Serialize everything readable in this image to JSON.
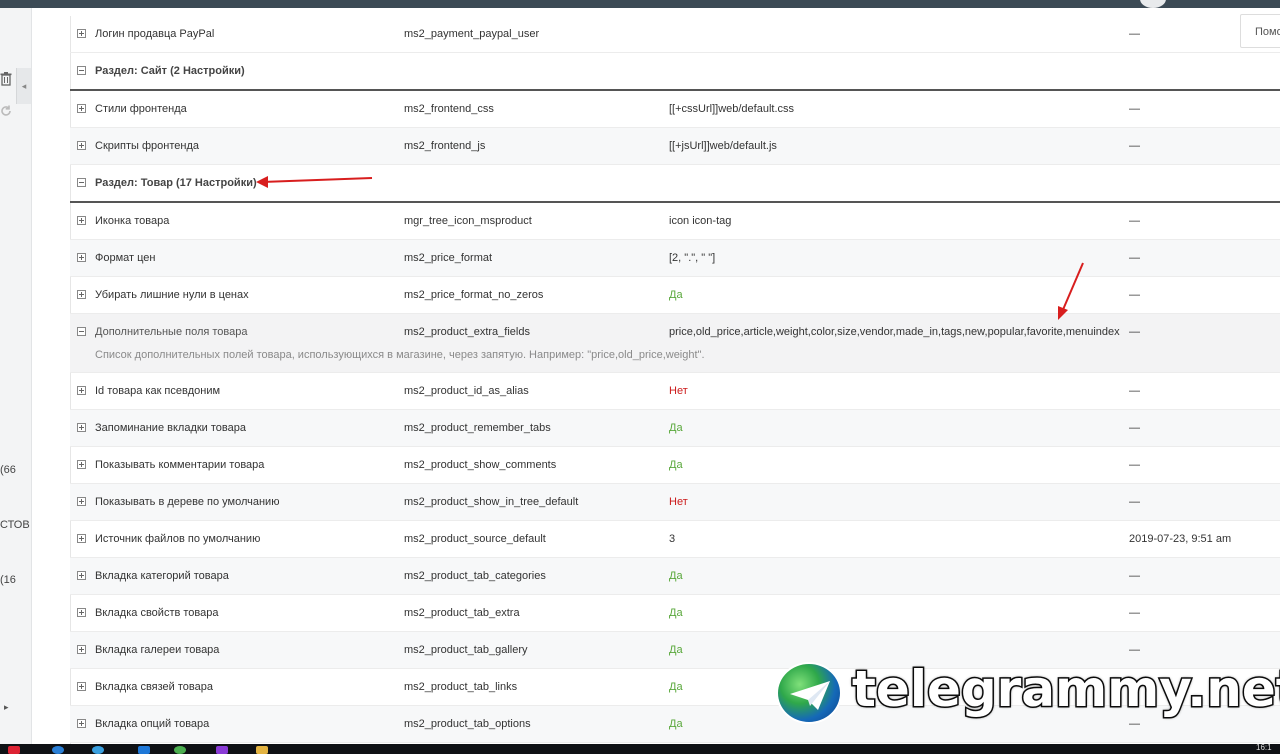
{
  "help_button": {
    "label": "Помо"
  },
  "sidebar": {
    "texts": [
      "(66",
      "СТОВ",
      "(16"
    ]
  },
  "rows": [
    {
      "type": "setting",
      "expanded": false,
      "name": "Логин продавца PayPal",
      "key": "ms2_payment_paypal_user",
      "value": "",
      "value_kind": "text",
      "date": "—"
    },
    {
      "type": "group",
      "label": "Раздел: Сайт (2 Настройки)"
    },
    {
      "type": "setting",
      "expanded": false,
      "name": "Стили фронтенда",
      "key": "ms2_frontend_css",
      "value": "[[+cssUrl]]web/default.css",
      "value_kind": "text",
      "date": "—"
    },
    {
      "type": "setting",
      "expanded": false,
      "name": "Скрипты фронтенда",
      "key": "ms2_frontend_js",
      "value": "[[+jsUrl]]web/default.js",
      "value_kind": "text",
      "date": "—"
    },
    {
      "type": "group",
      "label": "Раздел: Товар (17 Настройки)"
    },
    {
      "type": "setting",
      "expanded": false,
      "name": "Иконка товара",
      "key": "mgr_tree_icon_msproduct",
      "value": "icon icon-tag",
      "value_kind": "text",
      "date": "—"
    },
    {
      "type": "setting",
      "expanded": false,
      "name": "Формат цен",
      "key": "ms2_price_format",
      "value": "[2, \".\", \" \"]",
      "value_kind": "text",
      "date": "—"
    },
    {
      "type": "setting",
      "expanded": false,
      "name": "Убирать лишние нули в ценах",
      "key": "ms2_price_format_no_zeros",
      "value": "Да",
      "value_kind": "yes",
      "date": "—"
    },
    {
      "type": "setting",
      "expanded": true,
      "name": "Дополнительные поля товара",
      "key": "ms2_product_extra_fields",
      "value": "price,old_price,article,weight,color,size,vendor,made_in,tags,new,popular,favorite,menuindex",
      "value_kind": "text",
      "date": "—",
      "description": "Список дополнительных полей товара, использующихся в магазине, через запятую. Например: \"price,old_price,weight\"."
    },
    {
      "type": "setting",
      "expanded": false,
      "name": "Id товара как псевдоним",
      "key": "ms2_product_id_as_alias",
      "value": "Нет",
      "value_kind": "no",
      "date": "—"
    },
    {
      "type": "setting",
      "expanded": false,
      "name": "Запоминание вкладки товара",
      "key": "ms2_product_remember_tabs",
      "value": "Да",
      "value_kind": "yes",
      "date": "—"
    },
    {
      "type": "setting",
      "expanded": false,
      "name": "Показывать комментарии товара",
      "key": "ms2_product_show_comments",
      "value": "Да",
      "value_kind": "yes",
      "date": "—"
    },
    {
      "type": "setting",
      "expanded": false,
      "name": "Показывать в дереве по умолчанию",
      "key": "ms2_product_show_in_tree_default",
      "value": "Нет",
      "value_kind": "no",
      "date": "—"
    },
    {
      "type": "setting",
      "expanded": false,
      "name": "Источник файлов по умолчанию",
      "key": "ms2_product_source_default",
      "value": "3",
      "value_kind": "text",
      "date": "2019-07-23, 9:51 am"
    },
    {
      "type": "setting",
      "expanded": false,
      "name": "Вкладка категорий товара",
      "key": "ms2_product_tab_categories",
      "value": "Да",
      "value_kind": "yes",
      "date": "—"
    },
    {
      "type": "setting",
      "expanded": false,
      "name": "Вкладка свойств товара",
      "key": "ms2_product_tab_extra",
      "value": "Да",
      "value_kind": "yes",
      "date": "—"
    },
    {
      "type": "setting",
      "expanded": false,
      "name": "Вкладка галереи товара",
      "key": "ms2_product_tab_gallery",
      "value": "Да",
      "value_kind": "yes",
      "date": "—"
    },
    {
      "type": "setting",
      "expanded": false,
      "name": "Вкладка связей товара",
      "key": "ms2_product_tab_links",
      "value": "Да",
      "value_kind": "yes",
      "date": "—"
    },
    {
      "type": "setting",
      "expanded": false,
      "name": "Вкладка опций товара",
      "key": "ms2_product_tab_options",
      "value": "Да",
      "value_kind": "yes",
      "date": "—"
    }
  ],
  "watermark": {
    "text": "telegrammy.net"
  },
  "colors": {
    "yes": "#5aa83c",
    "no": "#cc1b1b",
    "annotation": "#d81e1e"
  },
  "icons": {
    "expand": "plus-square-icon",
    "collapse": "minus-square-icon",
    "trash": "trash-icon",
    "refresh": "refresh-icon"
  }
}
